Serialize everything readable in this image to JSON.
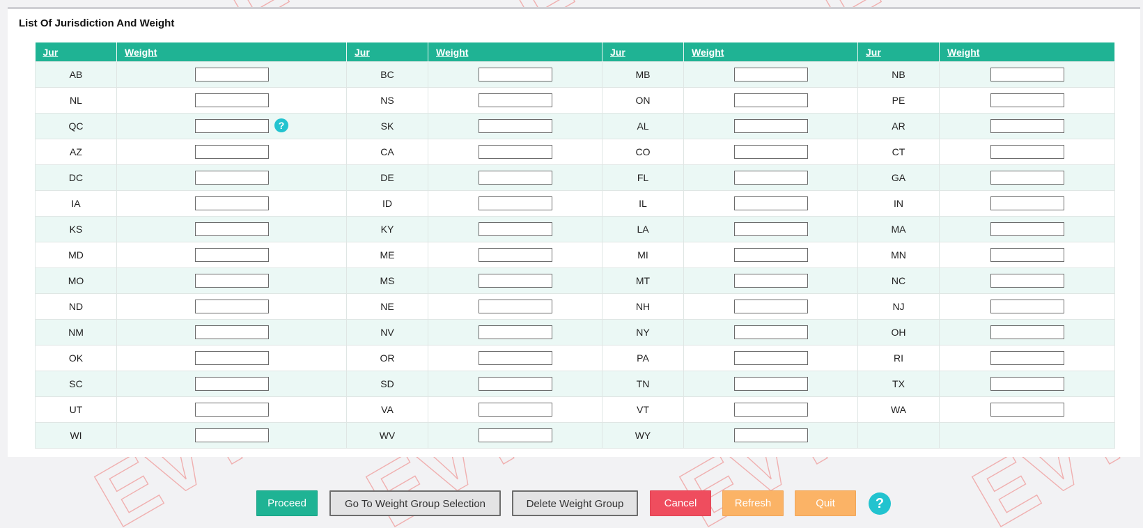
{
  "panel": {
    "title": "List Of Jurisdiction And Weight"
  },
  "table": {
    "headers": [
      "Jur",
      "Weight",
      "Jur",
      "Weight",
      "Jur",
      "Weight",
      "Jur",
      "Weight"
    ],
    "rows": [
      [
        "AB",
        "BC",
        "MB",
        "NB"
      ],
      [
        "NL",
        "NS",
        "ON",
        "PE"
      ],
      [
        "QC",
        "SK",
        "AL",
        "AR"
      ],
      [
        "AZ",
        "CA",
        "CO",
        "CT"
      ],
      [
        "DC",
        "DE",
        "FL",
        "GA"
      ],
      [
        "IA",
        "ID",
        "IL",
        "IN"
      ],
      [
        "KS",
        "KY",
        "LA",
        "MA"
      ],
      [
        "MD",
        "ME",
        "MI",
        "MN"
      ],
      [
        "MO",
        "MS",
        "MT",
        "NC"
      ],
      [
        "ND",
        "NE",
        "NH",
        "NJ"
      ],
      [
        "NM",
        "NV",
        "NY",
        "OH"
      ],
      [
        "OK",
        "OR",
        "PA",
        "RI"
      ],
      [
        "SC",
        "SD",
        "TN",
        "TX"
      ],
      [
        "UT",
        "VA",
        "VT",
        "WA"
      ],
      [
        "WI",
        "WV",
        "WY",
        ""
      ]
    ],
    "help_marker": "?"
  },
  "footer": {
    "proceed_label": "Proceed",
    "goto_label": "Go To Weight Group Selection",
    "delete_label": "Delete Weight Group",
    "cancel_label": "Cancel",
    "refresh_label": "Refresh",
    "quit_label": "Quit",
    "help_label": "?"
  },
  "watermark": {
    "text": "EVT"
  },
  "colors": {
    "header_green": "#1fb394",
    "row_tint": "#ebf8f5",
    "cancel_red": "#ef4d5e",
    "orange": "#fbb366",
    "help_cyan": "#22c3cf"
  }
}
